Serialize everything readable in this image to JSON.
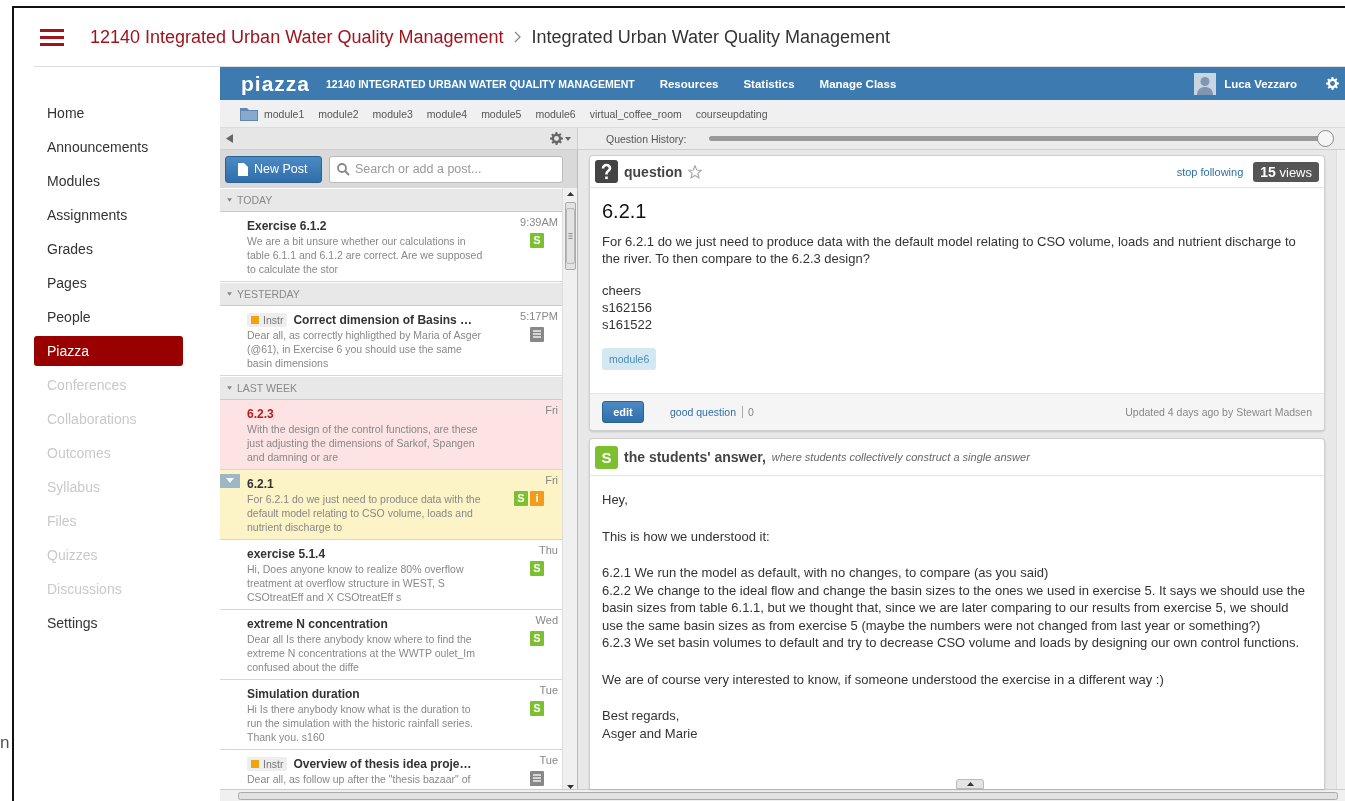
{
  "course_header": {
    "breadcrumb": [
      "12140 Integrated Urban Water Quality Management",
      "Integrated Urban Water Quality Management"
    ]
  },
  "stray_text": "n",
  "sidebar": {
    "items": [
      {
        "label": "Home",
        "selected": false,
        "disabled": false
      },
      {
        "label": "Announcements",
        "selected": false,
        "disabled": false
      },
      {
        "label": "Modules",
        "selected": false,
        "disabled": false
      },
      {
        "label": "Assignments",
        "selected": false,
        "disabled": false
      },
      {
        "label": "Grades",
        "selected": false,
        "disabled": false
      },
      {
        "label": "Pages",
        "selected": false,
        "disabled": false
      },
      {
        "label": "People",
        "selected": false,
        "disabled": false
      },
      {
        "label": "Piazza",
        "selected": true,
        "disabled": false
      },
      {
        "label": "Conferences",
        "selected": false,
        "disabled": true
      },
      {
        "label": "Collaborations",
        "selected": false,
        "disabled": true
      },
      {
        "label": "Outcomes",
        "selected": false,
        "disabled": true
      },
      {
        "label": "Syllabus",
        "selected": false,
        "disabled": true
      },
      {
        "label": "Files",
        "selected": false,
        "disabled": true
      },
      {
        "label": "Quizzes",
        "selected": false,
        "disabled": true
      },
      {
        "label": "Discussions",
        "selected": false,
        "disabled": true
      },
      {
        "label": "Settings",
        "selected": false,
        "disabled": false
      }
    ]
  },
  "piazza": {
    "logo": "piazza",
    "course": "12140 INTEGRATED URBAN WATER QUALITY MANAGEMENT",
    "nav": [
      "Resources",
      "Statistics",
      "Manage Class"
    ],
    "user": "Luca Vezzaro",
    "folders": [
      "module1",
      "module2",
      "module3",
      "module4",
      "module5",
      "module6",
      "virtual_coffee_room",
      "courseupdating"
    ],
    "question_history": {
      "label": "Question History:",
      "level": 1
    },
    "new_post": "New Post",
    "search": {
      "placeholder": "Search or add a post..."
    },
    "feed": [
      {
        "label": "TODAY",
        "posts": [
          {
            "title": "Exercise 6.1.2",
            "snippet": "We are a bit unsure whether our calculations in table 6.1.1 and 6.1.2 are correct. Are we supposed to calculate the stor",
            "time": "9:39AM",
            "badges": [
              {
                "kind": "student",
                "text": "S"
              }
            ],
            "selected": false,
            "unanswered": false
          }
        ]
      },
      {
        "label": "YESTERDAY",
        "posts": [
          {
            "tag": "Instr",
            "title": "Correct dimension of Basins …",
            "snippet": "Dear all, as correctly highligthed by Maria of Asger (@61), in Exercise 6 you should use the same basin dimensions",
            "time": "5:17PM",
            "badges": [
              {
                "kind": "note"
              }
            ],
            "selected": false,
            "unanswered": false
          }
        ]
      },
      {
        "label": "LAST WEEK",
        "posts": [
          {
            "title": "6.2.3",
            "snippet": "With the design of the control functions, are these just adjusting the dimensions of Sarkof, Spangen and damning or are",
            "time": "Fri",
            "selected": false,
            "unanswered": true
          },
          {
            "title": "6.2.1",
            "snippet": "For 6.2.1 do we just need to produce data with the default model relating to CSO volume, loads and nutrient discharge to",
            "time": "Fri",
            "badges": [
              {
                "kind": "student",
                "text": "S"
              },
              {
                "kind": "instructor",
                "text": "i"
              }
            ],
            "selected": true,
            "unanswered": false
          },
          {
            "title": "exercise 5.1.4",
            "snippet": "Hi, Does anyone know to realize 80% overflow treatment at overflow structure in WEST, S  CSOtreatEff and X  CSOtreatEff s",
            "time": "Thu",
            "badges": [
              {
                "kind": "student",
                "text": "S"
              }
            ],
            "selected": false,
            "unanswered": false
          },
          {
            "title": "extreme N concentration",
            "snippet": "Dear all Is there anybody know where to find the extreme N concentrations at the WWTP oulet_Im confused about the diffe",
            "time": "Wed",
            "badges": [
              {
                "kind": "student",
                "text": "S"
              }
            ],
            "selected": false,
            "unanswered": false
          },
          {
            "title": "Simulation duration",
            "snippet": "Hi Is there anybody know what is the duration to run the simulation with the historic rainfall series. Thank you. s160",
            "time": "Tue",
            "badges": [
              {
                "kind": "student",
                "text": "S"
              }
            ],
            "selected": false,
            "unanswered": false
          },
          {
            "tag": "Instr",
            "title": "Overview of thesis idea proje…",
            "snippet": "Dear all, as follow up after the \"thesis bazaar\" of",
            "time": "Tue",
            "badges": [
              {
                "kind": "note"
              }
            ],
            "selected": false,
            "unanswered": false
          }
        ]
      }
    ]
  },
  "question": {
    "type_label": "question",
    "starred": false,
    "follow_link": "stop following",
    "views_count": "15",
    "views_label": "views",
    "title": "6.2.1",
    "body": [
      "For 6.2.1 do we just need to produce data with the default model relating to CSO volume, loads and nutrient discharge to the river. To then compare to the 6.2.3 design?",
      "cheers\ns162156\ns161522"
    ],
    "tags": [
      "module6"
    ],
    "edit": "edit",
    "good_question": "good question",
    "good_count": "0",
    "updated": "Updated 4 days ago by Stewart Madsen"
  },
  "answer": {
    "icon": "S",
    "title": "the students' answer,",
    "subtitle": "where students collectively construct a single answer",
    "body": [
      "Hey,",
      "This is how we understood it:",
      "6.2.1 We run the model as default, with no changes, to compare (as you said)\n6.2.2 We change to the ideal flow and change the basin sizes to the ones we used in exercise 5. It says we should use the basin sizes from table 6.1.1, but we thought that, since we are later comparing to our results from exercise 5, we should use the same basin sizes as from exercise 5 (maybe the numbers were not changed from last year or something?)\n6.2.3 We set basin volumes to default and try to decrease CSO volume and loads by designing our own control functions.",
      "We are of course very interested to know, if someone understood the exercise in a different way :)",
      "Best regards,\nAsger and Marie"
    ]
  }
}
